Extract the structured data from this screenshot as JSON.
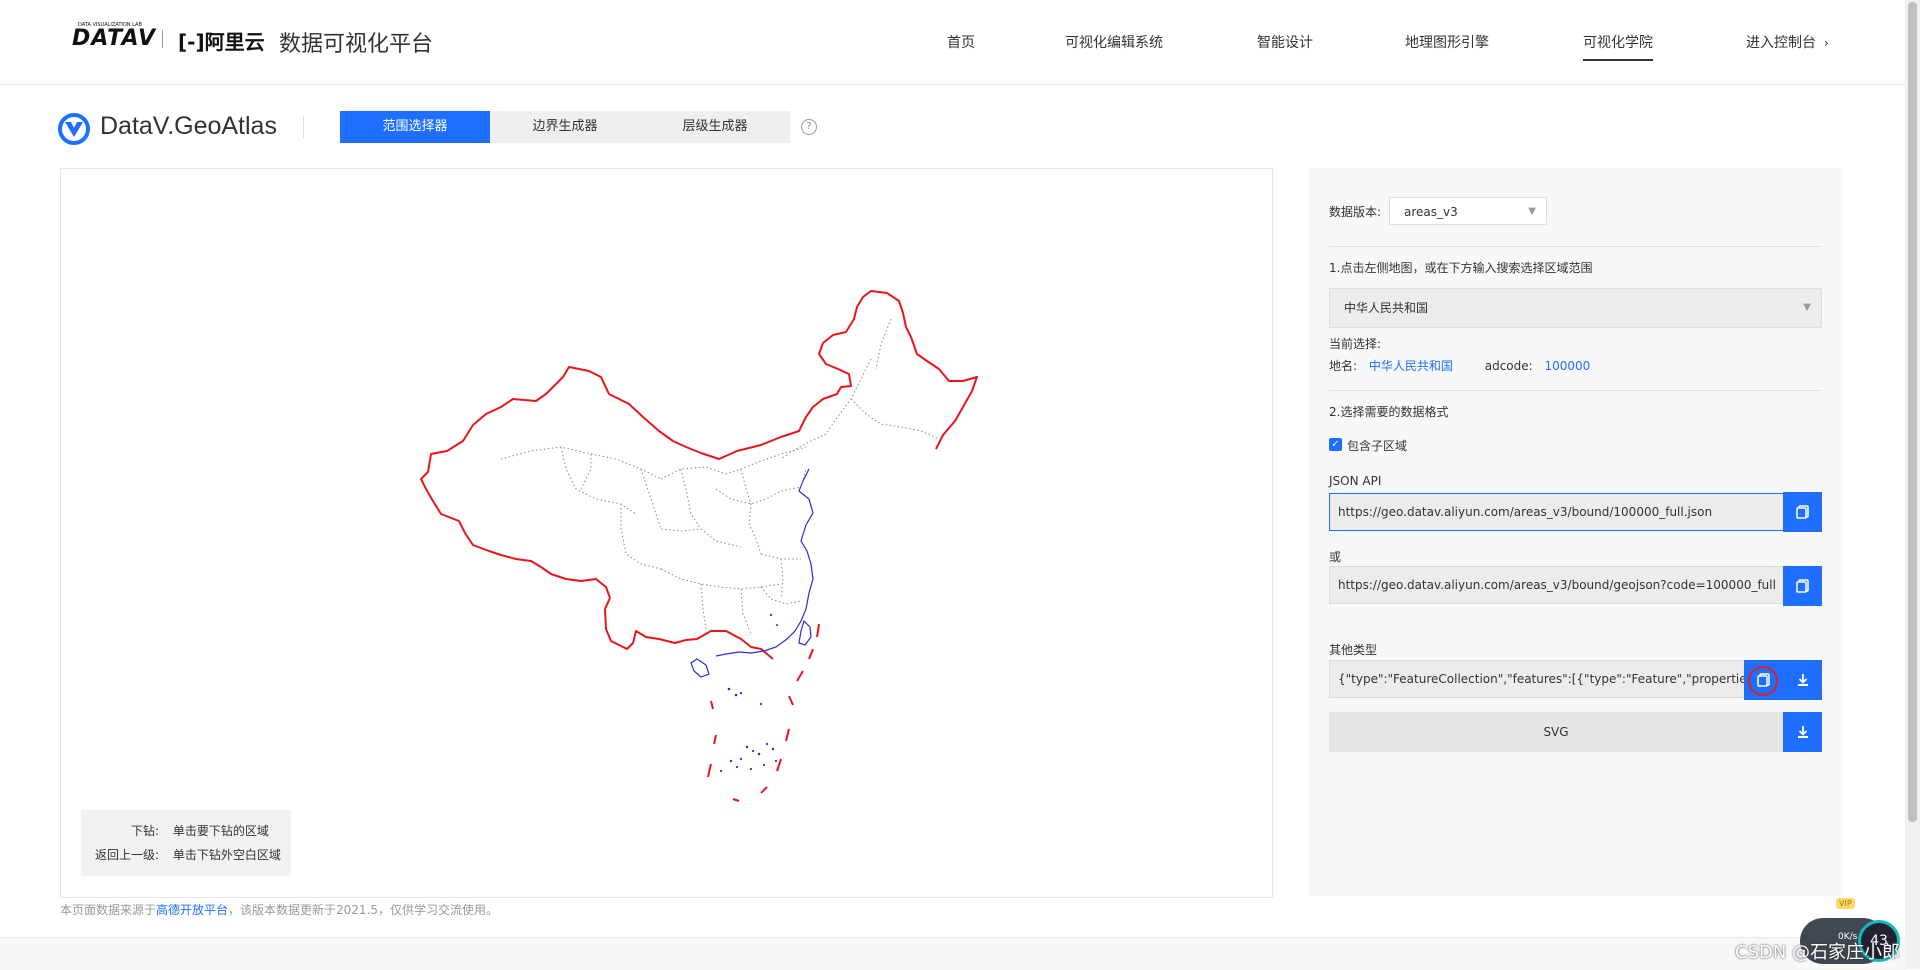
{
  "topnav": {
    "logo_mark": "DATAV",
    "logo_sub": "DATA VISUALIZATION LAB",
    "aliyun": "[-]阿里云",
    "site_title": "数据可视化平台",
    "items": [
      {
        "label": "首页"
      },
      {
        "label": "可视化编辑系统"
      },
      {
        "label": "智能设计"
      },
      {
        "label": "地理图形引擎"
      },
      {
        "label": "可视化学院"
      },
      {
        "label": "进入控制台"
      }
    ],
    "active_item": "可视化学院"
  },
  "atlas": {
    "name": "DataV.GeoAtlas",
    "tabs": [
      {
        "label": "范围选择器"
      },
      {
        "label": "边界生成器"
      },
      {
        "label": "层级生成器"
      }
    ],
    "active_tab": "范围选择器",
    "help": "?"
  },
  "map": {
    "hints": [
      {
        "key": "下钻:",
        "value": "单击要下钻的区域"
      },
      {
        "key": "返回上一级:",
        "value": "单击下钻外空白区域"
      }
    ],
    "colors": {
      "outline": "#e8161c",
      "coast": "#2a2ad8",
      "internal": "#888888"
    }
  },
  "footer": {
    "prefix": "本页面数据来源于",
    "link": "高德开放平台",
    "suffix": "，该版本数据更新于2021.5，仅供学习交流使用。"
  },
  "panel": {
    "version_label": "数据版本:",
    "version_value": "areas_v3",
    "step1": "1.点击左侧地图，或在下方输入搜索选择区域范围",
    "region_value": "中华人民共和国",
    "current_label": "当前选择:",
    "name_label": "地名:",
    "name_value": "中华人民共和国",
    "adcode_label": "adcode:",
    "adcode_value": "100000",
    "step2": "2.选择需要的数据格式",
    "include_sub": "包含子区域",
    "json_api_label": "JSON API",
    "json_api_url": "https://geo.datav.aliyun.com/areas_v3/bound/100000_full.json",
    "or_label": "或",
    "geojson_url": "https://geo.datav.aliyun.com/areas_v3/bound/geojson?code=100000_full",
    "other_label": "其他类型",
    "other_value": "{\"type\":\"FeatureCollection\",\"features\":[{\"type\":\"Feature\",\"properties\":{\"a",
    "svg_label": "SVG"
  },
  "overlay": {
    "watermark": "CSDN @石家庄小郎",
    "speed": "0K/s",
    "ring_value": "43",
    "vip": "VIP"
  },
  "accent": "#1e6fff"
}
